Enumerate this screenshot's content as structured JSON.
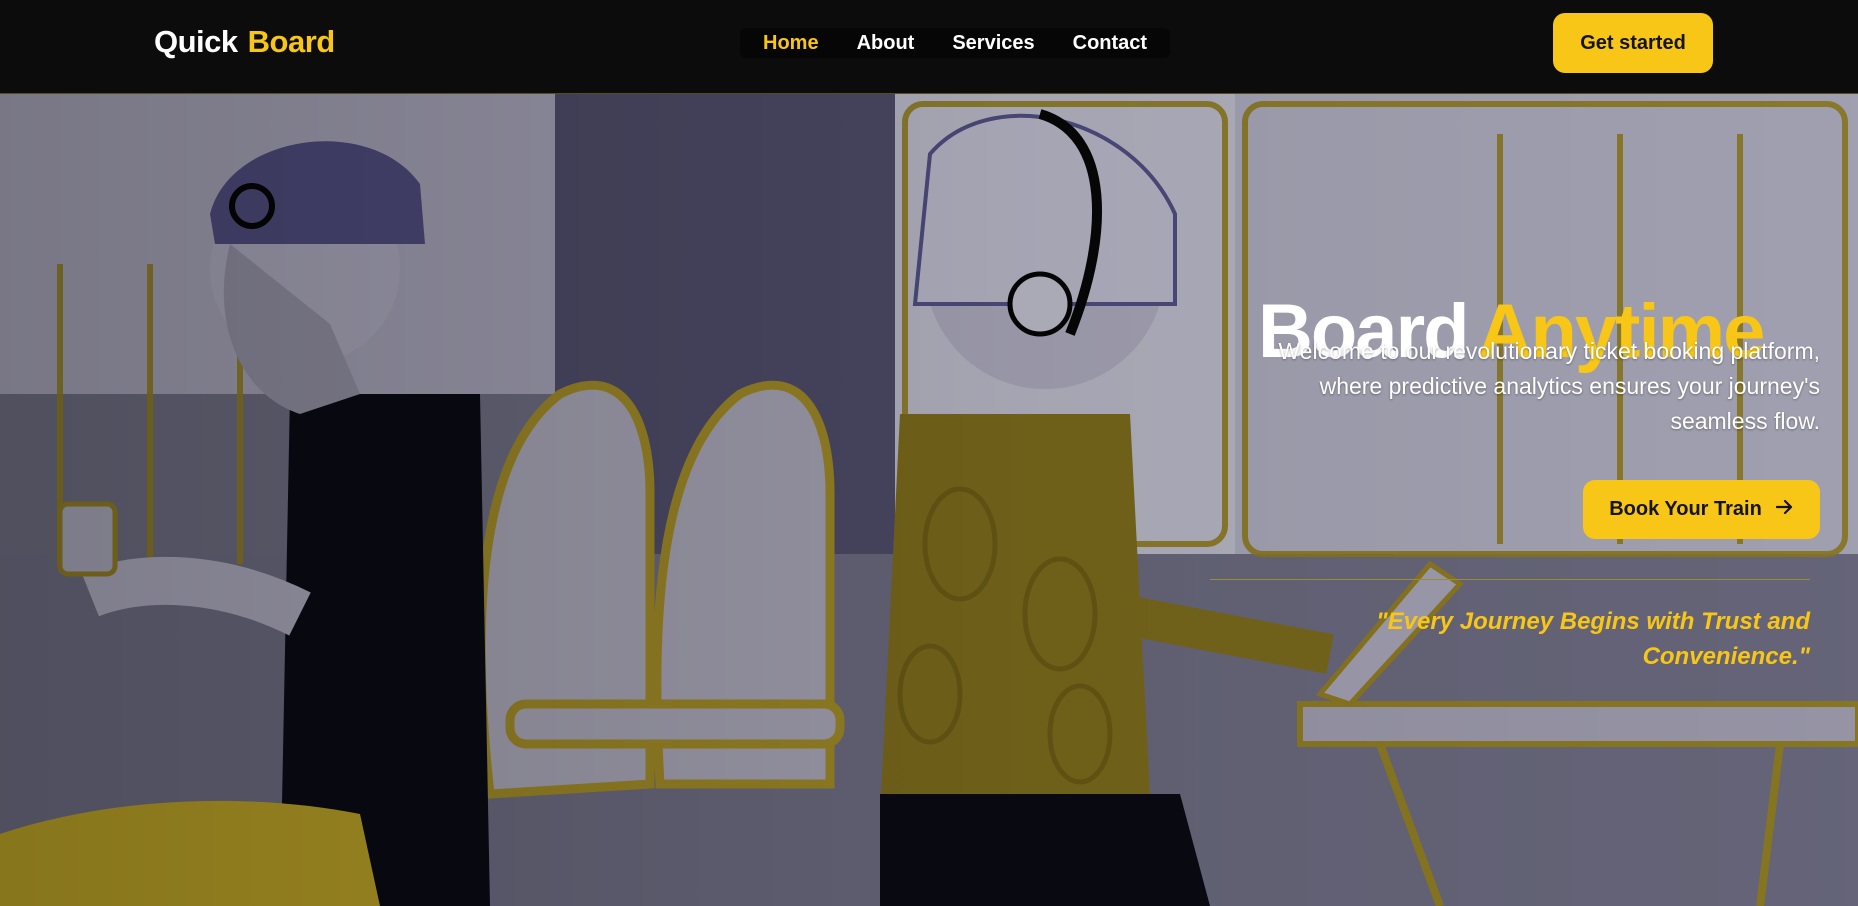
{
  "header": {
    "logo_primary": "Quick",
    "logo_accent": "Board",
    "nav": [
      {
        "label": "Home",
        "active": true
      },
      {
        "label": "About",
        "active": false
      },
      {
        "label": "Services",
        "active": false
      },
      {
        "label": "Contact",
        "active": false
      }
    ],
    "cta_label": "Get started"
  },
  "hero": {
    "title_primary": "Board",
    "title_accent": "Anytime",
    "description": "Welcome to our revolutionary ticket booking platform, where predictive analytics ensures your journey's seamless flow.",
    "button_label": "Book Your Train",
    "button_icon": "arrow-right-icon",
    "quote": "\"Every Journey Begins with Trust and Convenience.\""
  },
  "colors": {
    "accent": "#f7c616",
    "header_bg": "#0c0c0c",
    "text": "#ffffff"
  }
}
